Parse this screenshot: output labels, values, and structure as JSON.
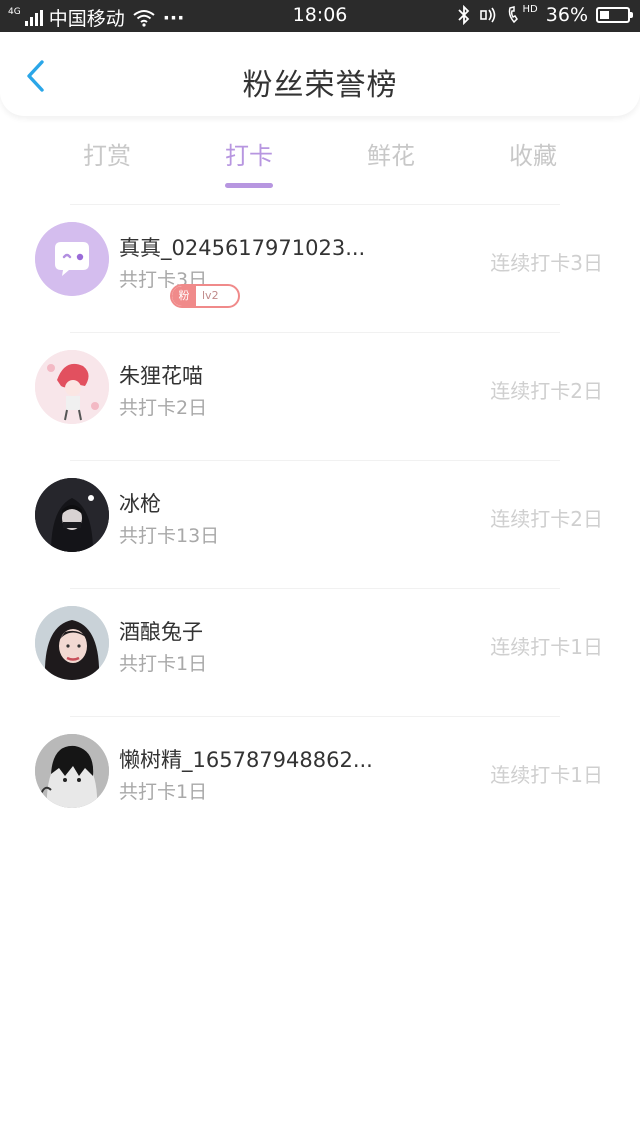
{
  "status_bar": {
    "network": "4G",
    "carrier": "中国移动",
    "dots": "···",
    "time": "18:06",
    "volte": "HD",
    "battery": "36%",
    "battery_level": 0.36
  },
  "header": {
    "title": "粉丝荣誉榜"
  },
  "tabs": [
    {
      "label": "打赏"
    },
    {
      "label": "打卡"
    },
    {
      "label": "鲜花"
    },
    {
      "label": "收藏"
    }
  ],
  "active_tab": 1,
  "colors": {
    "accent": "#b796e0",
    "badge": "#f08a8a",
    "back": "#2aa6e8"
  },
  "fans": [
    {
      "name": "真真_0245617971023...",
      "total": "共打卡3日",
      "streak": "连续打卡3日"
    },
    {
      "name": "朱狸花喵",
      "total": "共打卡2日",
      "streak": "连续打卡2日"
    },
    {
      "name": "冰枪",
      "total": "共打卡13日",
      "streak": "连续打卡2日",
      "badge": {
        "tag": "粉",
        "level": "lv2"
      }
    },
    {
      "name": "酒酿兔子",
      "total": "共打卡1日",
      "streak": "连续打卡1日"
    },
    {
      "name": "懒树精_165787948862...",
      "total": "共打卡1日",
      "streak": "连续打卡1日"
    }
  ]
}
